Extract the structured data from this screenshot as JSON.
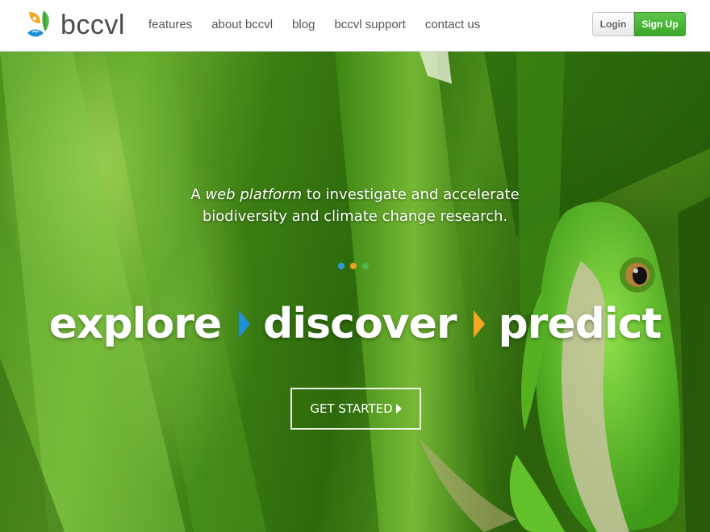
{
  "header": {
    "logo_text": "bccvl",
    "nav": [
      {
        "label": "features"
      },
      {
        "label": "about bccvl"
      },
      {
        "label": "blog"
      },
      {
        "label": "bccvl support"
      },
      {
        "label": "contact us"
      }
    ],
    "login_label": "Login",
    "signup_label": "Sign Up"
  },
  "hero": {
    "tagline_prefix": "A ",
    "tagline_emphasis": "web platform",
    "tagline_rest_line1": " to investigate and accelerate",
    "tagline_line2": "biodiversity and climate change research.",
    "carousel_dots": [
      {
        "color": "#2a9fe0"
      },
      {
        "color": "#f0a028"
      },
      {
        "color": "#4cb848"
      }
    ],
    "slogan": {
      "word1": "explore",
      "word2": "discover",
      "word3": "predict",
      "arrow1_color": "#1e90d8",
      "arrow2_color": "#f5a623"
    },
    "cta_label": "GET STARTED"
  },
  "colors": {
    "brand_green": "#3ba72a",
    "brand_blue": "#2a9fe0",
    "brand_orange": "#f0a028"
  }
}
